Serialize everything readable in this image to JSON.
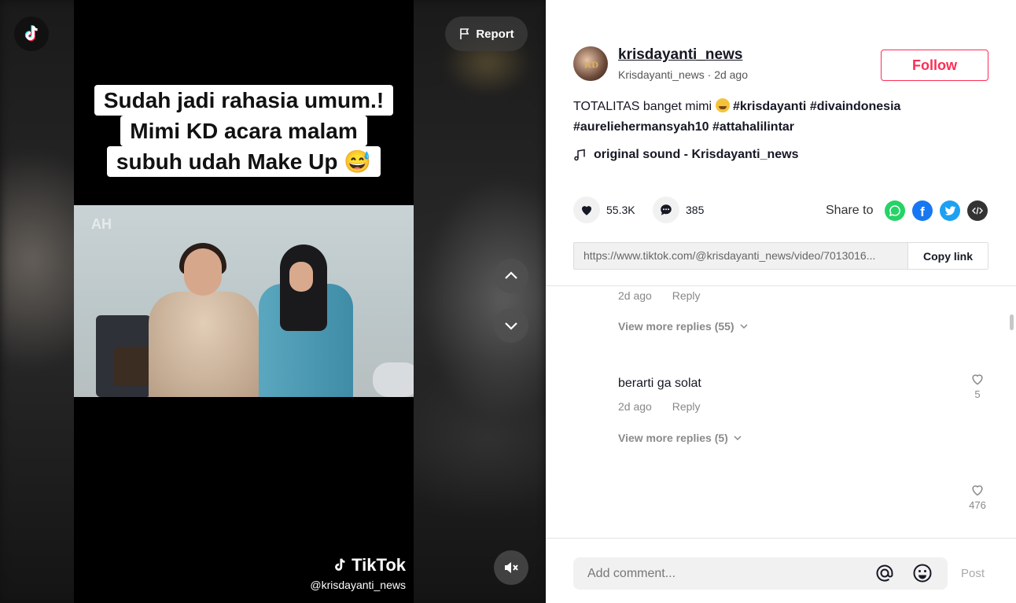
{
  "video": {
    "report_label": "Report",
    "caption_lines": [
      "Sudah jadi rahasia umum.!",
      "Mimi KD acara malam",
      "subuh udah Make Up 😅"
    ],
    "watermark_brand": "TikTok",
    "watermark_user": "@krisdayanti_news",
    "scene_mark": "AH"
  },
  "post": {
    "username": "krisdayanti_news",
    "display_name": "Krisdayanti_news",
    "separator": " · ",
    "time_ago": "2d ago",
    "follow_label": "Follow",
    "desc_text": "TOTALITAS banget mimi",
    "hashtags": [
      "#krisdayanti",
      "#divaindonesia",
      "#aureliehermansyah10",
      "#attahalilintar"
    ],
    "sound": "original sound - Krisdayanti_news",
    "likes": "55.3K",
    "comments_count": "385",
    "share_label": "Share to",
    "link": "https://www.tiktok.com/@krisdayanti_news/video/7013016...",
    "copy_label": "Copy link"
  },
  "comments": {
    "first": {
      "time": "2d ago",
      "reply": "Reply",
      "view_more": "View more replies (55)"
    },
    "second": {
      "text": "berarti ga solat",
      "time": "2d ago",
      "reply": "Reply",
      "likes": "5",
      "view_more": "View more replies (5)"
    },
    "third": {
      "likes": "476"
    }
  },
  "comment_bar": {
    "placeholder": "Add comment...",
    "post_label": "Post"
  },
  "colors": {
    "accent": "#fe2c55",
    "whatsapp": "#25d366",
    "facebook": "#1877f2",
    "twitter": "#1da1f2",
    "embed": "#333333"
  }
}
